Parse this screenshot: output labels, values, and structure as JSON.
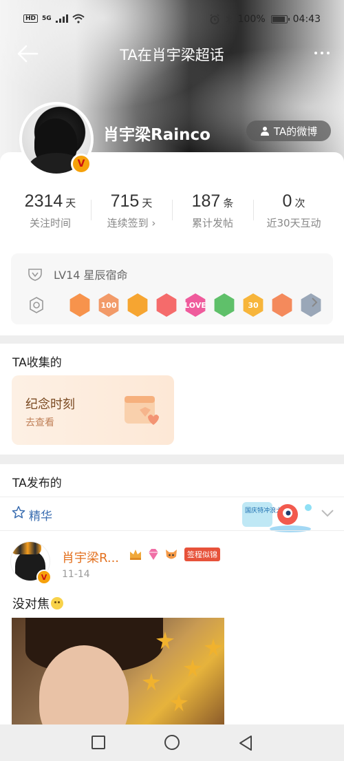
{
  "status_bar": {
    "network": "5G",
    "hd_label": "HD",
    "battery": "100%",
    "time": "04:43"
  },
  "nav": {
    "title": "TA在肖宇梁超话"
  },
  "profile": {
    "name": "肖宇梁Rainco",
    "verified_badge": "V",
    "weibo_button": "TA的微博"
  },
  "stats": [
    {
      "value": "2314",
      "unit": "天",
      "label": "关注时间"
    },
    {
      "value": "715",
      "unit": "天",
      "label": "连续签到 ›"
    },
    {
      "value": "187",
      "unit": "条",
      "label": "累计发帖"
    },
    {
      "value": "0",
      "unit": "次",
      "label": "近30天互动"
    }
  ],
  "level": {
    "text": "LV14 星辰宿命"
  },
  "badges": [
    {
      "icon": "fox-badge",
      "color": "#f7934c",
      "label": ""
    },
    {
      "icon": "100-days-badge",
      "color": "#f29a68",
      "label": "100"
    },
    {
      "icon": "crown-badge",
      "color": "#f6a531",
      "label": ""
    },
    {
      "icon": "bunny-badge",
      "color": "#f56b6b",
      "label": ""
    },
    {
      "icon": "love-badge",
      "color": "#ef5b9c",
      "label": "LOVE"
    },
    {
      "icon": "leaf-badge",
      "color": "#5fc06a",
      "label": ""
    },
    {
      "icon": "30-days-badge",
      "color": "#f7b53b",
      "label": "30"
    },
    {
      "icon": "hand-badge",
      "color": "#f48a5c",
      "label": ""
    },
    {
      "icon": "astronaut-badge",
      "color": "#9aa7b8",
      "label": ""
    }
  ],
  "collected": {
    "title": "TA收集的",
    "card_title": "纪念时刻",
    "card_link": "去查看"
  },
  "posted": {
    "title": "TA发布的",
    "filter_label": "精华",
    "promo_text": "国庆特冲浪大师"
  },
  "post": {
    "author": "肖宇梁R...",
    "tag": "签程似锦",
    "date": "11-14",
    "text": "没对焦"
  }
}
